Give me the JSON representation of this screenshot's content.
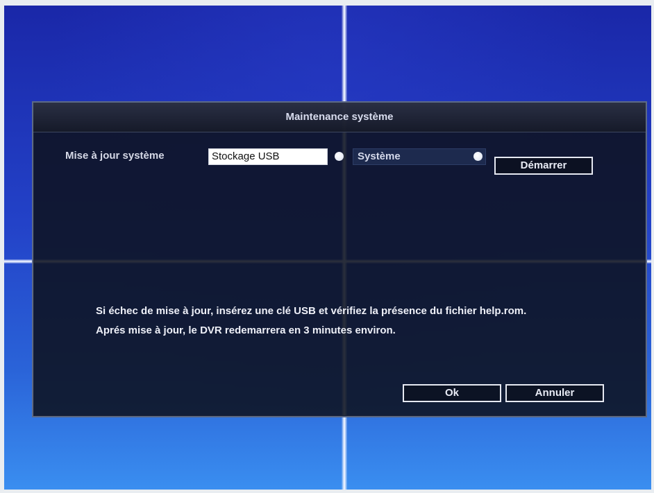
{
  "dialog": {
    "title": "Maintenance système"
  },
  "update_row": {
    "label": "Mise à jour système",
    "source_select": "Stockage USB",
    "target_select": "Système",
    "start_button": "Démarrer"
  },
  "info": {
    "line1": "Si échec de mise à jour, insérez une clé USB et vérifiez la présence du fichier help.rom.",
    "line2": "Aprés mise à jour, le DVR redemarrera en 3 minutes environ."
  },
  "footer": {
    "ok_button": "Ok",
    "cancel_button": "Annuler"
  },
  "colors": {
    "dialog_bg": "#0e1220",
    "screen_blue": "#2342c8",
    "text": "#eef0f8"
  }
}
